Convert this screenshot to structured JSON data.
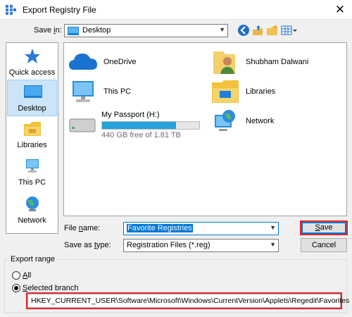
{
  "window": {
    "title": "Export Registry File",
    "close_symbol": "✕"
  },
  "toolbar": {
    "save_in_label": "Save in:",
    "save_in_value": "Desktop"
  },
  "places": [
    {
      "label": "Quick access",
      "icon": "star-icon"
    },
    {
      "label": "Desktop",
      "icon": "desktop-icon",
      "selected": true
    },
    {
      "label": "Libraries",
      "icon": "libraries-icon"
    },
    {
      "label": "This PC",
      "icon": "pc-icon"
    },
    {
      "label": "Network",
      "icon": "network-icon"
    }
  ],
  "files": {
    "onedrive": "OneDrive",
    "user": "Shubham Dalwani",
    "thispc": "This PC",
    "libraries": "Libraries",
    "passport": {
      "name": "My Passport (H:)",
      "free_text": "440 GB free of 1.81 TB",
      "used_fraction": 0.76
    },
    "network": "Network"
  },
  "form": {
    "filename_label": "File name:",
    "filename_value": "Favorite Registries",
    "type_label": "Save as type:",
    "type_value": "Registration Files (*.reg)",
    "save_label": "Save",
    "cancel_label": "Cancel"
  },
  "export": {
    "title": "Export range",
    "all_label": "All",
    "selected_label": "Selected branch",
    "branch_value": "HKEY_CURRENT_USER\\Software\\Microsoft\\Windows\\CurrentVersion\\Applets\\Regedit\\Favorites"
  },
  "colors": {
    "accent": "#0078d7",
    "highlight_box": "#e3242b",
    "drive_fill": "#26a0da"
  }
}
